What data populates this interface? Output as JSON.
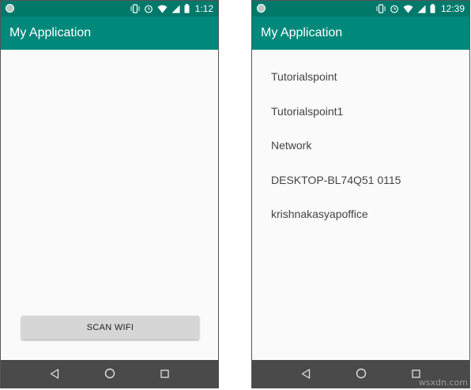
{
  "screens": [
    {
      "status_time": "1:12",
      "app_title": "My Application",
      "scan_button_label": "SCAN WIFI"
    },
    {
      "status_time": "12:39",
      "app_title": "My Application",
      "wifi_networks": [
        "Tutorialspoint",
        "Tutorialspoint1",
        "Network",
        "DESKTOP-BL74Q51 0115",
        "krishnakasyapoffice"
      ]
    }
  ],
  "status_icons": [
    "notification-dot-icon",
    "vibrate-icon",
    "alarm-icon",
    "wifi-icon",
    "signal-icon",
    "battery-icon"
  ],
  "nav_icons": [
    "back-icon",
    "home-icon",
    "recent-apps-icon"
  ],
  "colors": {
    "status_bar": "#00796b",
    "app_bar": "#00897b",
    "nav_bar": "#4a4a4a",
    "background": "#fafafa",
    "button": "#d6d6d6"
  },
  "watermark": "wsxdn.com"
}
